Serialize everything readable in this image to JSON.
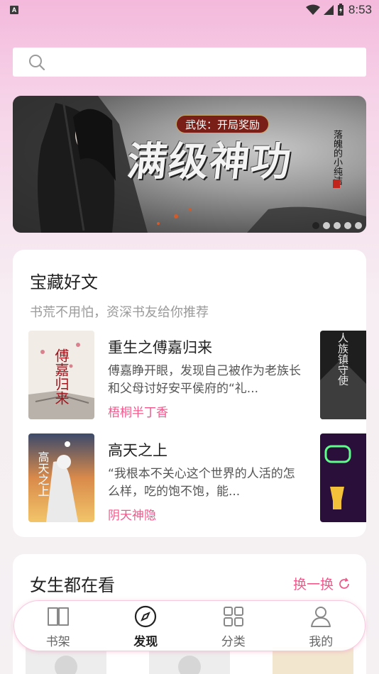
{
  "status_bar": {
    "left_icon": "A",
    "time": "8:53",
    "icons": [
      "wifi-icon",
      "signal-icon",
      "battery-icon"
    ]
  },
  "search": {
    "placeholder": ""
  },
  "banner": {
    "tag": "武侠：开局奖励",
    "title": "满级神功",
    "author": "落魄的小纯洁",
    "dots_count": 5,
    "active_dot": 0
  },
  "treasure": {
    "title": "宝藏好文",
    "subtitle": "书荒不用怕，资深书友给你推荐",
    "books": [
      {
        "title": "重生之傅嘉归来",
        "desc": "傅嘉睁开眼，发现自己被作为老族长和父母讨好安平侯府的“礼...",
        "author": "梧桐半丁香",
        "cover_text": "傅嘉归来"
      },
      {
        "title": "高天之上",
        "desc": "“我根本不关心这个世界的人活的怎么样，吃的饱不饱，能...",
        "author": "阴天神隐",
        "cover_text": "高天之上"
      }
    ],
    "side_covers": [
      {
        "cover_text": "人族镇守使"
      },
      {
        "cover_text": ""
      }
    ]
  },
  "girls": {
    "title": "女生都在看",
    "swap_label": "换一换"
  },
  "nav": {
    "items": [
      {
        "label": "书架",
        "icon": "book-icon"
      },
      {
        "label": "发现",
        "icon": "compass-icon",
        "active": true
      },
      {
        "label": "分类",
        "icon": "grid-icon"
      },
      {
        "label": "我的",
        "icon": "user-icon"
      }
    ]
  },
  "colors": {
    "accent": "#ef5a8c",
    "background_top": "#f4b9dc"
  }
}
